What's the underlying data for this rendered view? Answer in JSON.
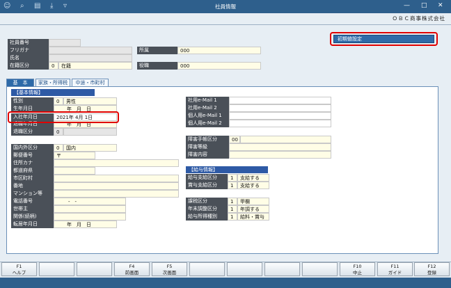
{
  "window": {
    "title": "社員情報",
    "company": "ＯＢＣ商事株式会社"
  },
  "toolbar_icons": [
    "person-add-icon",
    "search-icon",
    "print-icon",
    "download-icon",
    "filter-icon"
  ],
  "window_controls": {
    "minimize": "—",
    "maximize": "□",
    "close": "✕"
  },
  "defaults_button": "初期値設定",
  "header": {
    "employee_no": {
      "label": "社員番号",
      "value": ""
    },
    "furigana": {
      "label": "フリガナ",
      "value": ""
    },
    "name": {
      "label": "氏名",
      "value": ""
    },
    "status": {
      "label": "在籍区分",
      "code": "0",
      "value": "在籍"
    },
    "dept": {
      "label": "所属",
      "value": "000"
    },
    "position": {
      "label": "役職",
      "value": "000"
    }
  },
  "tabs": [
    "基　本",
    "家族・所得税",
    "中途・市町村"
  ],
  "basic": {
    "section_title": "【基本情報】",
    "gender": {
      "label": "性別",
      "code": "0",
      "value": "男性"
    },
    "birthdate": {
      "label": "生年月日",
      "value": "年　月　日"
    },
    "hire_date": {
      "label": "入社年月日",
      "value": "2021年 4月 1日"
    },
    "retire_date": {
      "label": "退職年月日",
      "value": "年　月　日"
    },
    "retire_type": {
      "label": "退職区分",
      "code": "0",
      "value": ""
    },
    "domestic": {
      "label": "国内外区分",
      "code": "0",
      "value": "国内"
    },
    "postal": {
      "label": "郵便番号",
      "value": "〒"
    },
    "addr_kana": {
      "label": "住所カナ",
      "value": ""
    },
    "prefecture": {
      "label": "都道府県",
      "value": ""
    },
    "city": {
      "label": "市区町村",
      "value": ""
    },
    "street": {
      "label": "番地",
      "value": ""
    },
    "building": {
      "label": "マンション等",
      "value": ""
    },
    "phone": {
      "label": "電話番号",
      "value": "-　-"
    },
    "householder": {
      "label": "世帯主",
      "value": ""
    },
    "relation": {
      "label": "関係(続柄)",
      "value": ""
    },
    "moved_date": {
      "label": "転居年月日",
      "value": "年　月　日"
    }
  },
  "mail": {
    "company1": {
      "label": "社用e-Mail 1",
      "value": ""
    },
    "company2": {
      "label": "社用e-Mail 2",
      "value": ""
    },
    "personal1": {
      "label": "個人用e-Mail 1",
      "value": ""
    },
    "personal2": {
      "label": "個人用e-Mail 2",
      "value": ""
    }
  },
  "disability": {
    "type": {
      "label": "障害手帳区分",
      "code": "00",
      "value": ""
    },
    "grade": {
      "label": "障害等級",
      "value": ""
    },
    "detail": {
      "label": "障害内容",
      "value": ""
    }
  },
  "salary": {
    "section_title": "【給与情報】",
    "pay_type": {
      "label": "給与支給区分",
      "code": "1",
      "value": "支給する"
    },
    "bonus_type": {
      "label": "賞与支給区分",
      "code": "1",
      "value": "支給する"
    },
    "tax_type": {
      "label": "課税区分",
      "code": "1",
      "value": "甲欄"
    },
    "year_end": {
      "label": "年末調整区分",
      "code": "1",
      "value": "年調する"
    },
    "income_type": {
      "label": "給与所得種別",
      "code": "1",
      "value": "給料・賞与"
    }
  },
  "fkeys": [
    {
      "key": "F1",
      "label": "ヘルプ"
    },
    {
      "key": "",
      "label": ""
    },
    {
      "key": "",
      "label": ""
    },
    {
      "key": "F4",
      "label": "前画面"
    },
    {
      "key": "F5",
      "label": "次画面"
    },
    {
      "key": "",
      "label": ""
    },
    {
      "key": "",
      "label": ""
    },
    {
      "key": "",
      "label": ""
    },
    {
      "key": "",
      "label": ""
    },
    {
      "key": "F10",
      "label": "中止"
    },
    {
      "key": "F11",
      "label": "ガイド"
    },
    {
      "key": "F12",
      "label": "登録"
    }
  ]
}
